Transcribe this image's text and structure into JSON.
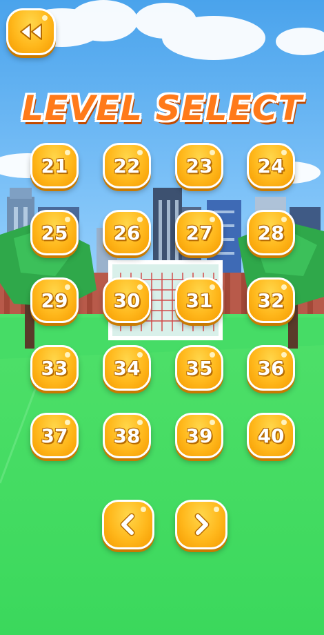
{
  "screen": {
    "title": "LEVEL SELECT"
  },
  "back_button": {
    "icon": "rewind-icon"
  },
  "levels": [
    {
      "label": "21"
    },
    {
      "label": "22"
    },
    {
      "label": "23"
    },
    {
      "label": "24"
    },
    {
      "label": "25"
    },
    {
      "label": "26"
    },
    {
      "label": "27"
    },
    {
      "label": "28"
    },
    {
      "label": "29"
    },
    {
      "label": "30"
    },
    {
      "label": "31"
    },
    {
      "label": "32"
    },
    {
      "label": "33"
    },
    {
      "label": "34"
    },
    {
      "label": "35"
    },
    {
      "label": "36"
    },
    {
      "label": "37"
    },
    {
      "label": "38"
    },
    {
      "label": "39"
    },
    {
      "label": "40"
    }
  ],
  "pagination": {
    "prev_icon": "chevron-left-icon",
    "next_icon": "chevron-right-icon"
  },
  "colors": {
    "button_fill": "#ffb81c",
    "button_border": "#ffffff",
    "title_color": "#ff7a1a",
    "sky": "#5aaef0",
    "grass": "#3fd860"
  }
}
